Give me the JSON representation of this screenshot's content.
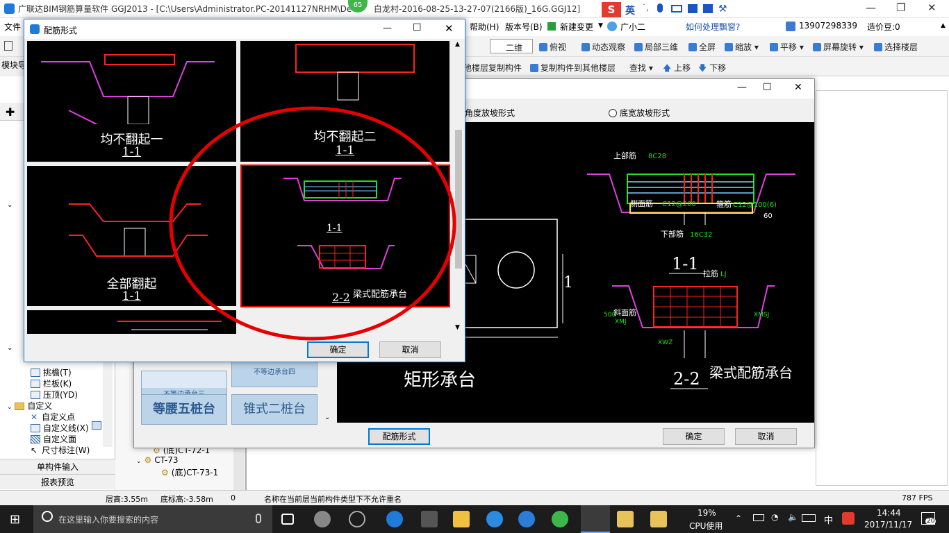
{
  "app": {
    "title": "广联达BIM钢筋算量软件 GGJ2013 - [C:\\Users\\Administrator.PC-20141127NRHM\\De",
    "title_tail": "白龙村-2016-08-25-13-27-07(2166版)_16G.GGJ12]",
    "badge": "65",
    "ime_label": "英"
  },
  "menu": {
    "file": "文件",
    "help": "帮助(H)",
    "version": "版本号(B)",
    "new_change": "新建变更",
    "assistant": "广小二",
    "popup_q": "如何处理飘窗?",
    "phone": "13907298339",
    "price_beans": "造价豆:0"
  },
  "toolbar": {
    "view2d": "二维",
    "top_view": "俯视",
    "dynamic": "动态观察",
    "local3d": "局部三维",
    "fullscreen": "全屏",
    "zoom": "缩放",
    "pan": "平移",
    "rotate": "屏幕旋转",
    "select_floor": "选择楼层",
    "copy_from_other": "他楼层复制构件",
    "copy_to_other": "复制构件到其他楼层",
    "find": "查找",
    "move_up": "上移",
    "move_down": "下移"
  },
  "left_panel": {
    "module_nav": "模块导",
    "items": [
      "挑檐(T)",
      "栏板(K)",
      "压顶(YD)",
      "自定义",
      "自定义点",
      "自定义线(X)",
      "自定义面",
      "尺寸标注(W)"
    ],
    "single_input": "单构件输入",
    "report_preview": "报表预览"
  },
  "mid_panel": {
    "cards": [
      "不等边承台三",
      "不等边承台四",
      "等腰五桩台",
      "锥式二桩台"
    ],
    "tree": [
      "(底)CT-72-1",
      "CT-73",
      "(底)CT-73-1"
    ]
  },
  "dialog2": {
    "radio_angle": "角度放坡形式",
    "radio_width": "底宽放坡形式",
    "drawing_title_left": "矩形承台",
    "section_label": "1",
    "top_bar": "上部筋",
    "top_bar_val": "8C28",
    "side_bar": "侧面筋",
    "side_bar_val": "C12@200",
    "stirrup": "箍筋",
    "stirrup_val": "C12@100(6)",
    "bottom_bar": "下部筋",
    "bottom_bar_val": "16C32",
    "angle": "60",
    "sec11": "1-1",
    "tie_bar": "拉筋",
    "tie_bar_val": "LJ",
    "slope_bar": "斜面筋",
    "slope_bar_val": "XMJ",
    "xwz": "XWZ",
    "xmsj": "XMSJ",
    "dim500": "500",
    "sec22": "2-2",
    "beam_cap": "梁式配筋承台",
    "config_button": "配筋形式",
    "ok": "确定",
    "cancel": "取消"
  },
  "dialog1": {
    "title": "配筋形式",
    "tiles": [
      {
        "caption": "均不翻起一",
        "section": "1-1"
      },
      {
        "caption": "均不翻起二",
        "section": "1-1"
      },
      {
        "caption": "全部翻起",
        "section": "1-1"
      },
      {
        "caption": "梁式配筋承台",
        "section_a": "1-1",
        "section_b": "2-2"
      }
    ],
    "ok": "确定",
    "cancel": "取消"
  },
  "status": {
    "floor_height": "层高:3.55m",
    "base_height": "底标高:-3.58m",
    "zero": "0",
    "message": "名称在当前层当前构件类型下不允许重名",
    "fps": "787 FPS"
  },
  "taskbar": {
    "search_placeholder": "在这里输入你要搜索的内容",
    "cpu_pct": "19%",
    "cpu_label": "CPU使用",
    "lang": "中",
    "time": "14:44",
    "date": "2017/11/17",
    "notif_count": "20"
  },
  "colors": {
    "accent": "#0078d7",
    "highlight_circle": "#e60000",
    "rebar_magenta": "#e040e0",
    "rebar_red": "#ff2020",
    "rebar_green": "#20e020",
    "rebar_yellow": "#f0f020"
  }
}
